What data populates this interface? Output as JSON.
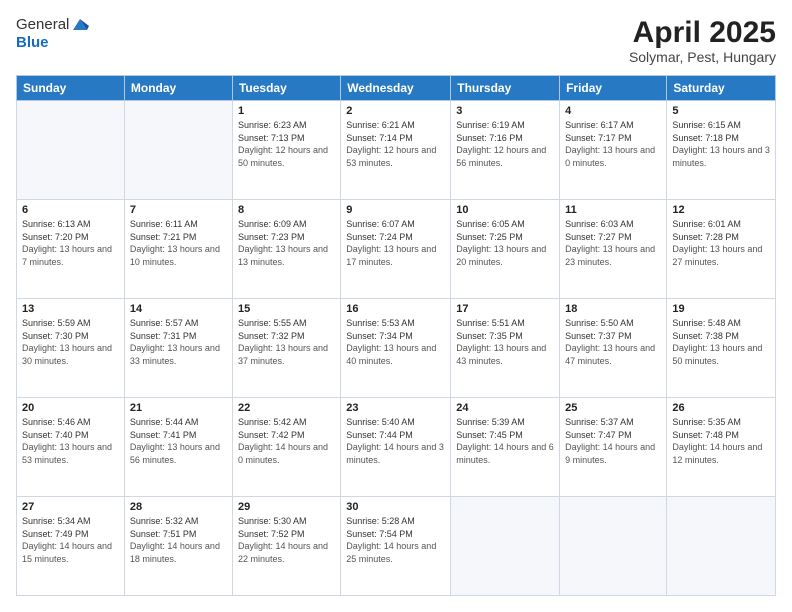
{
  "logo": {
    "general": "General",
    "blue": "Blue"
  },
  "header": {
    "month": "April 2025",
    "location": "Solymar, Pest, Hungary"
  },
  "weekdays": [
    "Sunday",
    "Monday",
    "Tuesday",
    "Wednesday",
    "Thursday",
    "Friday",
    "Saturday"
  ],
  "weeks": [
    [
      {
        "num": "",
        "sunrise": "",
        "sunset": "",
        "daylight": ""
      },
      {
        "num": "",
        "sunrise": "",
        "sunset": "",
        "daylight": ""
      },
      {
        "num": "1",
        "sunrise": "Sunrise: 6:23 AM",
        "sunset": "Sunset: 7:13 PM",
        "daylight": "Daylight: 12 hours and 50 minutes."
      },
      {
        "num": "2",
        "sunrise": "Sunrise: 6:21 AM",
        "sunset": "Sunset: 7:14 PM",
        "daylight": "Daylight: 12 hours and 53 minutes."
      },
      {
        "num": "3",
        "sunrise": "Sunrise: 6:19 AM",
        "sunset": "Sunset: 7:16 PM",
        "daylight": "Daylight: 12 hours and 56 minutes."
      },
      {
        "num": "4",
        "sunrise": "Sunrise: 6:17 AM",
        "sunset": "Sunset: 7:17 PM",
        "daylight": "Daylight: 13 hours and 0 minutes."
      },
      {
        "num": "5",
        "sunrise": "Sunrise: 6:15 AM",
        "sunset": "Sunset: 7:18 PM",
        "daylight": "Daylight: 13 hours and 3 minutes."
      }
    ],
    [
      {
        "num": "6",
        "sunrise": "Sunrise: 6:13 AM",
        "sunset": "Sunset: 7:20 PM",
        "daylight": "Daylight: 13 hours and 7 minutes."
      },
      {
        "num": "7",
        "sunrise": "Sunrise: 6:11 AM",
        "sunset": "Sunset: 7:21 PM",
        "daylight": "Daylight: 13 hours and 10 minutes."
      },
      {
        "num": "8",
        "sunrise": "Sunrise: 6:09 AM",
        "sunset": "Sunset: 7:23 PM",
        "daylight": "Daylight: 13 hours and 13 minutes."
      },
      {
        "num": "9",
        "sunrise": "Sunrise: 6:07 AM",
        "sunset": "Sunset: 7:24 PM",
        "daylight": "Daylight: 13 hours and 17 minutes."
      },
      {
        "num": "10",
        "sunrise": "Sunrise: 6:05 AM",
        "sunset": "Sunset: 7:25 PM",
        "daylight": "Daylight: 13 hours and 20 minutes."
      },
      {
        "num": "11",
        "sunrise": "Sunrise: 6:03 AM",
        "sunset": "Sunset: 7:27 PM",
        "daylight": "Daylight: 13 hours and 23 minutes."
      },
      {
        "num": "12",
        "sunrise": "Sunrise: 6:01 AM",
        "sunset": "Sunset: 7:28 PM",
        "daylight": "Daylight: 13 hours and 27 minutes."
      }
    ],
    [
      {
        "num": "13",
        "sunrise": "Sunrise: 5:59 AM",
        "sunset": "Sunset: 7:30 PM",
        "daylight": "Daylight: 13 hours and 30 minutes."
      },
      {
        "num": "14",
        "sunrise": "Sunrise: 5:57 AM",
        "sunset": "Sunset: 7:31 PM",
        "daylight": "Daylight: 13 hours and 33 minutes."
      },
      {
        "num": "15",
        "sunrise": "Sunrise: 5:55 AM",
        "sunset": "Sunset: 7:32 PM",
        "daylight": "Daylight: 13 hours and 37 minutes."
      },
      {
        "num": "16",
        "sunrise": "Sunrise: 5:53 AM",
        "sunset": "Sunset: 7:34 PM",
        "daylight": "Daylight: 13 hours and 40 minutes."
      },
      {
        "num": "17",
        "sunrise": "Sunrise: 5:51 AM",
        "sunset": "Sunset: 7:35 PM",
        "daylight": "Daylight: 13 hours and 43 minutes."
      },
      {
        "num": "18",
        "sunrise": "Sunrise: 5:50 AM",
        "sunset": "Sunset: 7:37 PM",
        "daylight": "Daylight: 13 hours and 47 minutes."
      },
      {
        "num": "19",
        "sunrise": "Sunrise: 5:48 AM",
        "sunset": "Sunset: 7:38 PM",
        "daylight": "Daylight: 13 hours and 50 minutes."
      }
    ],
    [
      {
        "num": "20",
        "sunrise": "Sunrise: 5:46 AM",
        "sunset": "Sunset: 7:40 PM",
        "daylight": "Daylight: 13 hours and 53 minutes."
      },
      {
        "num": "21",
        "sunrise": "Sunrise: 5:44 AM",
        "sunset": "Sunset: 7:41 PM",
        "daylight": "Daylight: 13 hours and 56 minutes."
      },
      {
        "num": "22",
        "sunrise": "Sunrise: 5:42 AM",
        "sunset": "Sunset: 7:42 PM",
        "daylight": "Daylight: 14 hours and 0 minutes."
      },
      {
        "num": "23",
        "sunrise": "Sunrise: 5:40 AM",
        "sunset": "Sunset: 7:44 PM",
        "daylight": "Daylight: 14 hours and 3 minutes."
      },
      {
        "num": "24",
        "sunrise": "Sunrise: 5:39 AM",
        "sunset": "Sunset: 7:45 PM",
        "daylight": "Daylight: 14 hours and 6 minutes."
      },
      {
        "num": "25",
        "sunrise": "Sunrise: 5:37 AM",
        "sunset": "Sunset: 7:47 PM",
        "daylight": "Daylight: 14 hours and 9 minutes."
      },
      {
        "num": "26",
        "sunrise": "Sunrise: 5:35 AM",
        "sunset": "Sunset: 7:48 PM",
        "daylight": "Daylight: 14 hours and 12 minutes."
      }
    ],
    [
      {
        "num": "27",
        "sunrise": "Sunrise: 5:34 AM",
        "sunset": "Sunset: 7:49 PM",
        "daylight": "Daylight: 14 hours and 15 minutes."
      },
      {
        "num": "28",
        "sunrise": "Sunrise: 5:32 AM",
        "sunset": "Sunset: 7:51 PM",
        "daylight": "Daylight: 14 hours and 18 minutes."
      },
      {
        "num": "29",
        "sunrise": "Sunrise: 5:30 AM",
        "sunset": "Sunset: 7:52 PM",
        "daylight": "Daylight: 14 hours and 22 minutes."
      },
      {
        "num": "30",
        "sunrise": "Sunrise: 5:28 AM",
        "sunset": "Sunset: 7:54 PM",
        "daylight": "Daylight: 14 hours and 25 minutes."
      },
      {
        "num": "",
        "sunrise": "",
        "sunset": "",
        "daylight": ""
      },
      {
        "num": "",
        "sunrise": "",
        "sunset": "",
        "daylight": ""
      },
      {
        "num": "",
        "sunrise": "",
        "sunset": "",
        "daylight": ""
      }
    ]
  ]
}
